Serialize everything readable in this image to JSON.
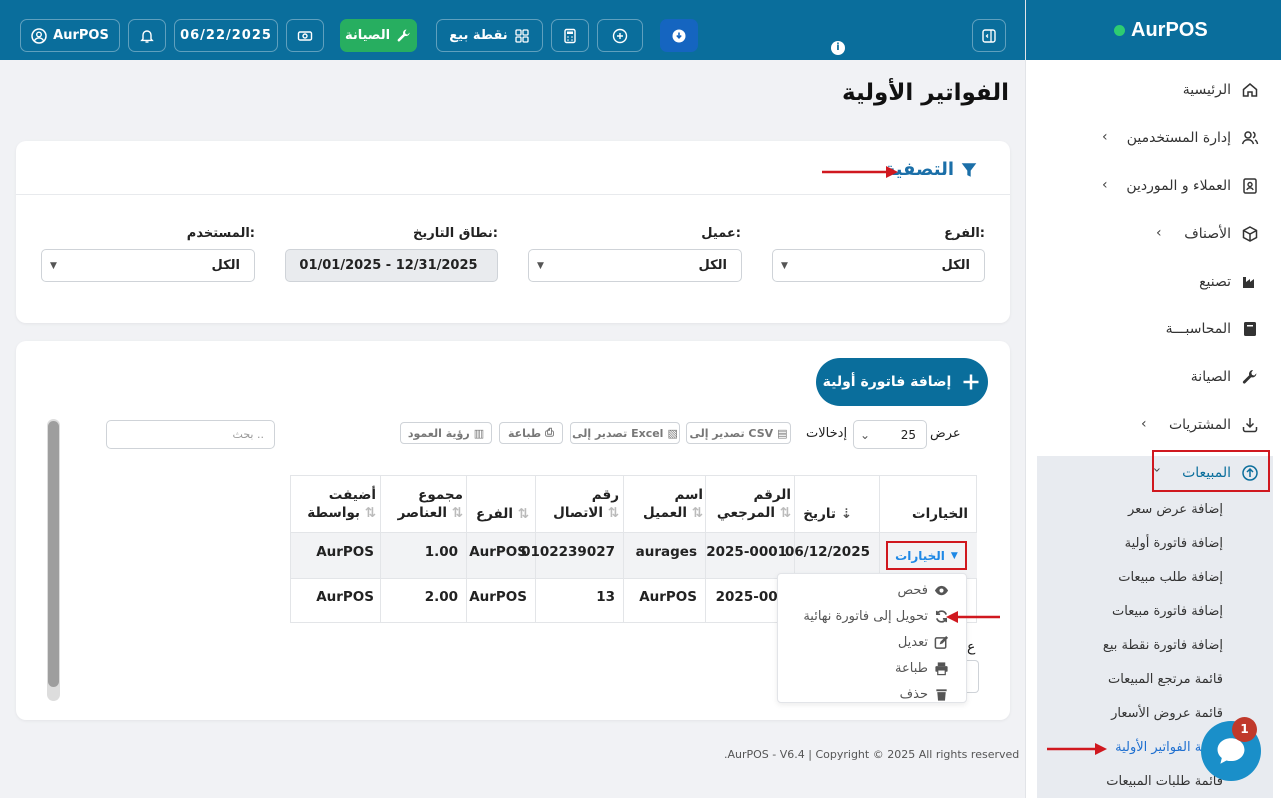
{
  "brand": {
    "name": "AurPOS"
  },
  "topbar": {
    "user_label": "AurPOS",
    "date": "06/22/2025",
    "maintenance_label": "الصيانة",
    "pos_label": "نقطة بيع"
  },
  "sidebar": {
    "items": [
      {
        "label": "الرئيسية",
        "icon": "home-icon"
      },
      {
        "label": "إدارة المستخدمين",
        "icon": "users-icon"
      },
      {
        "label": "العملاء و الموردين",
        "icon": "contacts-icon"
      },
      {
        "label": "الأصناف",
        "icon": "box-icon"
      },
      {
        "label": "تصنيع",
        "icon": "factory-icon"
      },
      {
        "label": "المحاسبـــة",
        "icon": "book-icon"
      },
      {
        "label": "الصيانة",
        "icon": "wrench-icon"
      },
      {
        "label": "المشتريات",
        "icon": "download-icon"
      },
      {
        "label": "المبيعات",
        "icon": "upload-icon"
      }
    ],
    "sales_subitems": [
      "إضافة عرض سعر",
      "إضافة فاتورة أولية",
      "إضافة طلب مبيعات",
      "إضافة فاتورة مبيعات",
      "إضافة فاتورة نقطة بيع",
      "قائمة مرتجع المبيعات",
      "قائمة عروض الأسعار",
      "قائمة الفواتير الأولية",
      "قائمة طلبات المبيعات"
    ]
  },
  "page": {
    "title": "الفواتير الأولية"
  },
  "filter": {
    "title": "التصفية",
    "branch_label": "الفرع:",
    "branch_value": "الكل",
    "client_label": "عميل:",
    "client_value": "الكل",
    "date_label": "نطاق التاريخ:",
    "date_value": "01/01/2025 - 12/31/2025",
    "user_label": "المستخدم:",
    "user_value": "الكل"
  },
  "list": {
    "add_button": "إضافة فاتورة أولية",
    "show_label": "عرض",
    "entries_value": "25",
    "entries_label": "إدخالات",
    "export_csv": "تصدير إلى CSV",
    "export_excel": "تصدير إلى Excel",
    "print": "طباعة",
    "column_visibility": "رؤية العمود",
    "search_placeholder": "بحث ..",
    "columns": [
      "الخيارات",
      "تاريخ",
      "الرقم المرجعي",
      "اسم العميل",
      "رقم الاتصال",
      "الفرع",
      "مجموع العناصر",
      "أضيفت بواسطة"
    ],
    "rows": [
      {
        "options": "الخيارات",
        "date": "06/12/2025",
        "ref": "2025-0001",
        "customer": "aurages",
        "phone": "0102239027",
        "branch": "AurPOS",
        "total": "1.00",
        "added_by": "AurPOS"
      },
      {
        "options": "",
        "date": "",
        "ref": "2025-000",
        "customer": "AurPOS",
        "phone": "13",
        "branch": "AurPOS",
        "total": "2.00",
        "added_by": "AurPOS"
      }
    ],
    "dropdown": [
      "فحص",
      "تحويل إلى فاتورة نهائية",
      "تعديل",
      "طباعة",
      "حذف"
    ],
    "partial_label": "ع"
  },
  "footer": {
    "text": ".AurPOS - V6.4 | Copyright © 2025 All rights reserved"
  },
  "chat": {
    "badge": "1"
  },
  "colors": {
    "primary": "#0a6e9c",
    "green": "#27ae60",
    "annotation": "#d0181f"
  }
}
